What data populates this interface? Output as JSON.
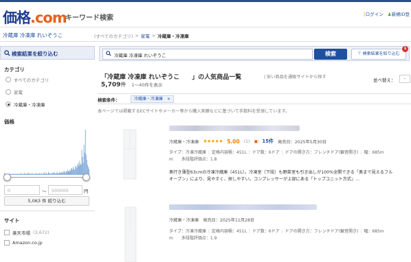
{
  "header": {
    "logo_main": "価格",
    "logo_dot": ".",
    "logo_com": "com",
    "tagline": "キーワード検索",
    "login": "ログイン",
    "register": "新規ID登"
  },
  "breadcrumb": {
    "page_heading": "冷蔵庫 冷凍庫 れいぞうこ",
    "all_categories": "(すべてのカテゴリ)",
    "sep": ">",
    "category": "家電",
    "current": "冷蔵庫・冷凍庫"
  },
  "sidebar": {
    "header": "検索結果を絞り込む",
    "category_title": "カテゴリ",
    "categories": [
      {
        "label": "すべてのカテゴリ",
        "selected": false
      },
      {
        "label": "家電",
        "selected": false
      },
      {
        "label": "冷蔵庫・冷凍庫",
        "selected": true
      }
    ],
    "price_title": "価格",
    "price_min_placeholder": "0",
    "price_tilde": "～",
    "price_max_placeholder": "500000",
    "price_unit": "円",
    "price_histogram": [
      2,
      1,
      1,
      1,
      1,
      1,
      1,
      1,
      1,
      1,
      1,
      1,
      1,
      1,
      1,
      1,
      1,
      1,
      1,
      1,
      1,
      1,
      1,
      2,
      1,
      1,
      1,
      1,
      2,
      1,
      1,
      1,
      1,
      2,
      1,
      2,
      1,
      1,
      1,
      2,
      1,
      1,
      1,
      1,
      1,
      2,
      1,
      1,
      1,
      2,
      1,
      1,
      2,
      1,
      1,
      2,
      1,
      3,
      1,
      2,
      1,
      1,
      3,
      2,
      1,
      1,
      2,
      1,
      2,
      2,
      3,
      1,
      2,
      1,
      3,
      2,
      1,
      2,
      3,
      2,
      2,
      3,
      2,
      3,
      4,
      3,
      2,
      4,
      3,
      5,
      4,
      3,
      5,
      4,
      6,
      7,
      5,
      8,
      6,
      5,
      9,
      8,
      7,
      10,
      12,
      9,
      14,
      11,
      10,
      25,
      18,
      12,
      30,
      22,
      45,
      20,
      15,
      10,
      8,
      6
    ],
    "narrow_button": "5,063 件 絞り込む",
    "site_title": "サイト",
    "sites": [
      {
        "label": "楽天市場",
        "count": "(3,672)"
      },
      {
        "label": "Amazon.co.jp",
        "count": ""
      }
    ]
  },
  "search": {
    "query": "冷蔵庫 冷凍庫 れいぞうこ",
    "button": "検索",
    "narrow_button": "検索結果を絞り込む",
    "badge": "1"
  },
  "results": {
    "title": "「冷蔵庫 冷凍庫 れいぞうこ　　」の人気商品一覧",
    "subtitle": "| 安い商品を通販サイトから探す",
    "count": "5,709",
    "count_unit": "件",
    "range": "1〜40件を表示",
    "sort_label": "並べ替え：",
    "sort_value": "-",
    "condition_label": "検索条件：",
    "condition_chip": "冷蔵庫・冷凍庫　×",
    "note": "本ページでは掲載するECサイトやメーカー等から購入実績などに基づいて手数料を受領しています。"
  },
  "items": [
    {
      "category": "冷蔵庫・冷凍庫",
      "stars": "★★★★★",
      "score": "5.00",
      "score_count": "(1)",
      "flame": "▣",
      "shop_count": "15件",
      "release": "発売日：2025年5月30日",
      "specs_line1": [
        "タイプ：冷凍冷蔵庫",
        "定格内容積：451L",
        "ドア数：6ドア",
        "ドアの開き方：フレンチドア(観音開き)",
        "幅：685m"
      ],
      "specs_line2": "m　　多段階評価点：1.8",
      "desc_line1": "奥行き薄型63cmの冷凍冷蔵庫（451L）。冷凍室（下段）も野菜室も引き出しが100%全開できる「奥まで見えるフル",
      "desc_line2": "オープン」により、見やすく、探しやすい。コンプレッサーが上部にある「トップユニット方式」..."
    },
    {
      "category": "冷蔵庫・冷凍庫",
      "release": "発売日：2025年11月28日",
      "specs_line1": [
        "タイプ：冷凍冷蔵庫",
        "定格内容積：451L",
        "ドア数：6ドア",
        "ドアの開き方：フレンチドア(観音開き)",
        "幅：685m"
      ],
      "specs_line2": "m　　多段階評価点：1.9"
    }
  ],
  "colors": {
    "brand": "#1f3f8f",
    "accent": "#e8601c",
    "search_button": "#1f4f9f",
    "histogram": "#7aa6d8"
  }
}
